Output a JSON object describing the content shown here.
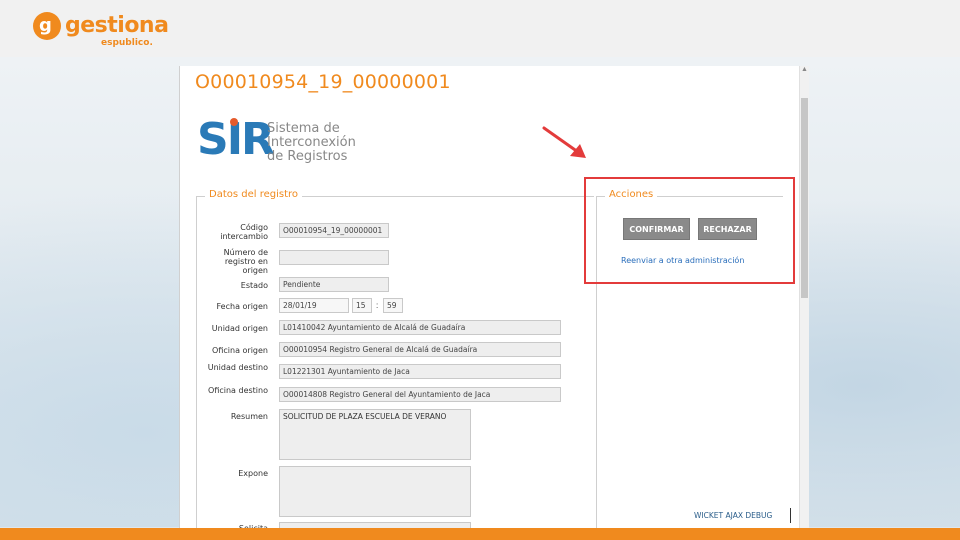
{
  "brand": {
    "logo_mark": "g",
    "name": "gestiona",
    "subtitle": "espublico.",
    "accent_color": "#f08a1e"
  },
  "record": {
    "title": "O00010954_19_00000001"
  },
  "sir_logo": {
    "letters": "SIR",
    "text_lines": [
      "Sistema de",
      "Interconexión",
      "de Registros"
    ]
  },
  "datos": {
    "legend": "Datos del registro",
    "fields": {
      "codigo": {
        "label": "Código intercambio",
        "value": "O00010954_19_00000001"
      },
      "numero": {
        "label": "Número de registro en origen",
        "value": ""
      },
      "estado": {
        "label": "Estado",
        "value": "Pendiente"
      },
      "fecha": {
        "label": "Fecha origen",
        "value": "28/01/19",
        "hour": "15",
        "minute": "59",
        "sep": ":"
      },
      "unidad_origen": {
        "label": "Unidad origen",
        "value": "L01410042 Ayuntamiento de Alcalá de Guadaíra"
      },
      "oficina_origen": {
        "label": "Oficina origen",
        "value": "O00010954 Registro General de Alcalá de Guadaíra"
      },
      "unidad_destino": {
        "label": "Unidad destino",
        "value": "L01221301 Ayuntamiento de Jaca"
      },
      "oficina_destino": {
        "label": "Oficina destino",
        "value": "O00014808 Registro General del Ayuntamiento de Jaca"
      },
      "resumen": {
        "label": "Resumen",
        "value": "SOLICITUD DE PLAZA ESCUELA DE VERANO"
      },
      "expone": {
        "label": "Expone",
        "value": ""
      },
      "solicita": {
        "label": "Solicita",
        "value": ""
      }
    }
  },
  "acciones": {
    "legend": "Acciones",
    "confirm_label": "CONFIRMAR",
    "reject_label": "RECHAZAR",
    "forward_link": "Reenviar a otra administración",
    "highlight_color": "#e33b3b"
  },
  "debug": {
    "label": "WICKET AJAX DEBUG"
  }
}
